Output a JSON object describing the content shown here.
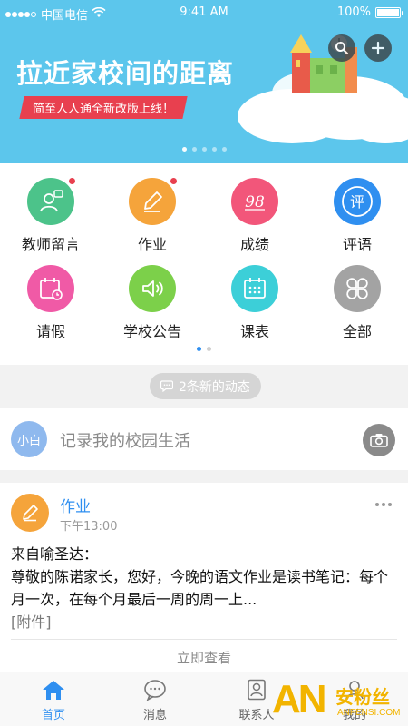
{
  "status_bar": {
    "carrier": "中国电信",
    "time": "9:41 AM",
    "battery": "100%"
  },
  "banner": {
    "title": "拉近家校间的距离",
    "ribbon": "简至人人通全新改版上线！",
    "active_dot": 0,
    "dot_count": 5
  },
  "grid": {
    "items": [
      {
        "label": "教师留言",
        "color": "#4cc38a",
        "icon": "teacher-message-icon",
        "badge": true
      },
      {
        "label": "作业",
        "color": "#f5a43b",
        "icon": "homework-pencil-icon",
        "badge": true
      },
      {
        "label": "成绩",
        "color": "#f2567a",
        "icon": "score-98-icon",
        "badge": false
      },
      {
        "label": "评语",
        "color": "#2f8ff0",
        "icon": "comment-ping-icon",
        "badge": false
      },
      {
        "label": "请假",
        "color": "#f05aa6",
        "icon": "leave-calendar-icon",
        "badge": false
      },
      {
        "label": "学校公告",
        "color": "#7cd04a",
        "icon": "speaker-icon",
        "badge": false
      },
      {
        "label": "课表",
        "color": "#3ccfd8",
        "icon": "schedule-calendar-icon",
        "badge": false
      },
      {
        "label": "全部",
        "color": "#a3a3a3",
        "icon": "all-clover-icon",
        "badge": false
      }
    ],
    "score_glyph": "98",
    "comment_glyph": "评"
  },
  "news": {
    "label": "2条新的动态"
  },
  "record": {
    "avatar_text": "小白",
    "placeholder": "记录我的校园生活"
  },
  "post": {
    "title": "作业",
    "time": "下午13:00",
    "from": "来自喻圣达：",
    "body": "尊敬的陈诺家长，您好，今晚的语文作业是读书笔记：每个月一次，在每个月最后一周的周一上...",
    "attachment": "[附件]",
    "view_label": "立即查看"
  },
  "tabbar": {
    "tabs": [
      {
        "label": "首页",
        "icon": "home-icon",
        "active": true
      },
      {
        "label": "消息",
        "icon": "message-bubble-icon",
        "active": false
      },
      {
        "label": "联系人",
        "icon": "contacts-icon",
        "active": false
      },
      {
        "label": "我的",
        "icon": "profile-icon",
        "active": false
      }
    ]
  },
  "colors": {
    "banner_bg": "#5cc6ec",
    "accent": "#2f8ff0",
    "ribbon": "#e8404f"
  },
  "watermark": {
    "brand": "AN",
    "name": "安粉丝",
    "url": "ANFENSI.COM"
  }
}
